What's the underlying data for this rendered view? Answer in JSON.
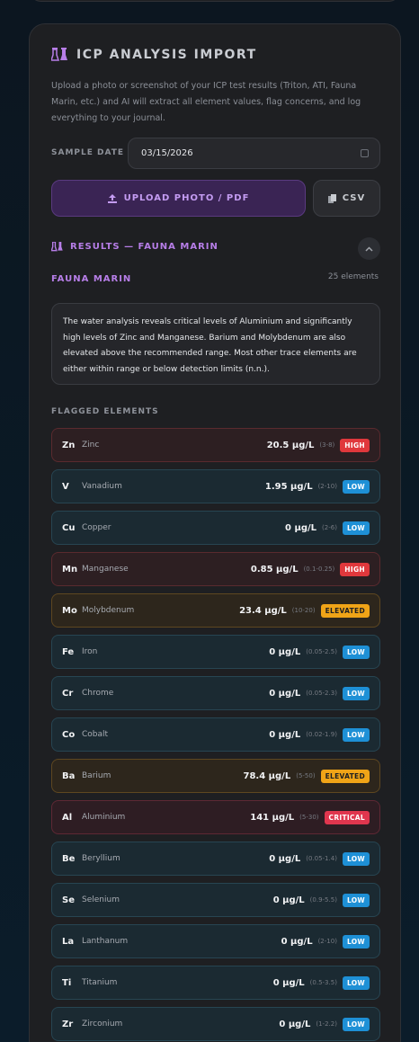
{
  "card": {
    "title": "ICP ANALYSIS IMPORT",
    "description": "Upload a photo or screenshot of your ICP test results (Triton, ATI, Fauna Marin, etc.) and AI will extract all element values, flag concerns, and log everything to your journal.",
    "sample_date_label": "SAMPLE DATE",
    "sample_date_value": "03/15/2026",
    "upload_label": "UPLOAD PHOTO / PDF",
    "csv_label": "CSV"
  },
  "results": {
    "header": "RESULTS — FAUNA MARIN",
    "lab_name": "FAUNA MARIN",
    "element_count": "25 elements",
    "summary": "The water analysis reveals critical levels of Aluminium and significantly high levels of Zinc and Manganese. Barium and Molybdenum are also elevated above the recommended range. Most other trace elements are either within range or below detection limits (n.n.).",
    "flagged_title": "FLAGGED ELEMENTS"
  },
  "colors": {
    "accent_purple": "#b77ee8",
    "low": "#1e90d6",
    "high": "#e0383c",
    "critical": "#e0364e",
    "elevated": "#f0a417"
  },
  "elements": [
    {
      "symbol": "Zn",
      "name": "Zinc",
      "value": "20.5 µg/L",
      "range": "(3-8)",
      "status": "HIGH",
      "level": "high"
    },
    {
      "symbol": "V",
      "name": "Vanadium",
      "value": "1.95 µg/L",
      "range": "(2-10)",
      "status": "LOW",
      "level": "low"
    },
    {
      "symbol": "Cu",
      "name": "Copper",
      "value": "0 µg/L",
      "range": "(2-6)",
      "status": "LOW",
      "level": "low"
    },
    {
      "symbol": "Mn",
      "name": "Manganese",
      "value": "0.85 µg/L",
      "range": "(0.1-0.25)",
      "status": "HIGH",
      "level": "high"
    },
    {
      "symbol": "Mo",
      "name": "Molybdenum",
      "value": "23.4 µg/L",
      "range": "(10-20)",
      "status": "ELEVATED",
      "level": "elevated"
    },
    {
      "symbol": "Fe",
      "name": "Iron",
      "value": "0 µg/L",
      "range": "(0.05-2.5)",
      "status": "LOW",
      "level": "low"
    },
    {
      "symbol": "Cr",
      "name": "Chrome",
      "value": "0 µg/L",
      "range": "(0.05-2.3)",
      "status": "LOW",
      "level": "low"
    },
    {
      "symbol": "Co",
      "name": "Cobalt",
      "value": "0 µg/L",
      "range": "(0.02-1.9)",
      "status": "LOW",
      "level": "low"
    },
    {
      "symbol": "Ba",
      "name": "Barium",
      "value": "78.4 µg/L",
      "range": "(5-50)",
      "status": "ELEVATED",
      "level": "elevated"
    },
    {
      "symbol": "Al",
      "name": "Aluminium",
      "value": "141 µg/L",
      "range": "(5-30)",
      "status": "CRITICAL",
      "level": "critical"
    },
    {
      "symbol": "Be",
      "name": "Beryllium",
      "value": "0 µg/L",
      "range": "(0.05-1.4)",
      "status": "LOW",
      "level": "low"
    },
    {
      "symbol": "Se",
      "name": "Selenium",
      "value": "0 µg/L",
      "range": "(0.9-5.5)",
      "status": "LOW",
      "level": "low"
    },
    {
      "symbol": "La",
      "name": "Lanthanum",
      "value": "0 µg/L",
      "range": "(2-10)",
      "status": "LOW",
      "level": "low"
    },
    {
      "symbol": "Ti",
      "name": "Titanium",
      "value": "0 µg/L",
      "range": "(0.5-3.5)",
      "status": "LOW",
      "level": "low"
    },
    {
      "symbol": "Zr",
      "name": "Zirconium",
      "value": "0 µg/L",
      "range": "(1-2.2)",
      "status": "LOW",
      "level": "low"
    }
  ]
}
